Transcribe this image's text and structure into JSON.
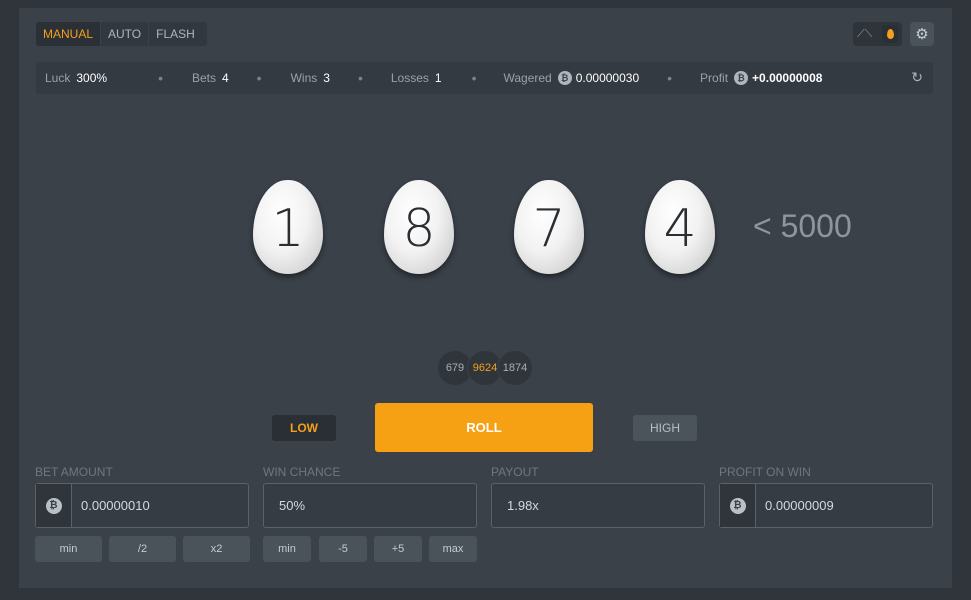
{
  "tabs": [
    {
      "label": "MANUAL",
      "active": true
    },
    {
      "label": "AUTO",
      "active": false
    },
    {
      "label": "FLASH",
      "active": false
    }
  ],
  "toggle": {
    "chart_icon": "chart-icon",
    "egg_icon": "egg-icon"
  },
  "settings_icon": "gear-icon",
  "stats": {
    "luck_label": "Luck",
    "luck": "300%",
    "bets_label": "Bets",
    "bets": "4",
    "wins_label": "Wins",
    "wins": "3",
    "losses_label": "Losses",
    "losses": "1",
    "wagered_label": "Wagered",
    "wagered": "0.00000030",
    "profit_label": "Profit",
    "profit": "+0.00000008",
    "refresh_icon": "refresh-icon",
    "coin_symbol": "₿"
  },
  "roll": {
    "digits": [
      "1",
      "8",
      "7",
      "4"
    ],
    "target": "< 5000"
  },
  "history": [
    "679",
    "9624",
    "1874"
  ],
  "buttons": {
    "low": "LOW",
    "roll": "ROLL",
    "high": "HIGH"
  },
  "fields": {
    "bet_amount": {
      "label": "BET AMOUNT",
      "value": "0.00000010"
    },
    "win_chance": {
      "label": "WIN CHANCE",
      "value": "50%"
    },
    "payout": {
      "label": "PAYOUT",
      "value": "1.98x"
    },
    "profit_on_win": {
      "label": "PROFIT ON WIN",
      "value": "0.00000009"
    }
  },
  "bet_buttons": [
    "min",
    "/2",
    "x2"
  ],
  "chance_buttons": [
    "min",
    "-5",
    "+5",
    "max"
  ],
  "colors": {
    "accent": "#f6a013",
    "background": "#3a4149"
  }
}
